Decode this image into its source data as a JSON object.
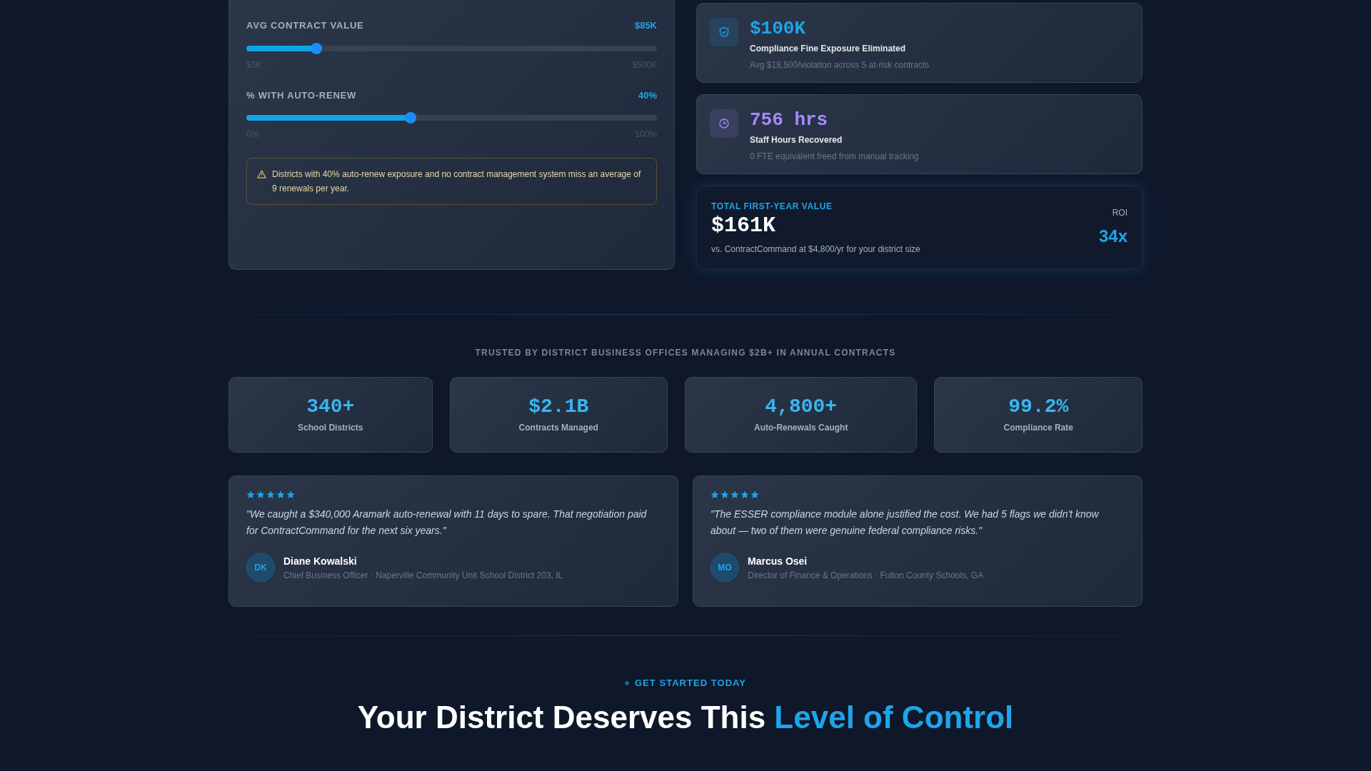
{
  "calculator": {
    "sliders": [
      {
        "label": "AVG CONTRACT VALUE",
        "reading": "$85K",
        "level": 0.17,
        "min_label": "$5K",
        "max_label": "$500K"
      },
      {
        "label": "% WITH AUTO-RENEW",
        "reading": "40%",
        "level": 0.4,
        "min_label": "0%",
        "max_label": "100%"
      }
    ],
    "warning": "Districts with 40% auto-renew exposure and no contract management system miss an average of 9 renewals per year."
  },
  "results": [
    {
      "kind": "shield",
      "value": "$100K",
      "title": "Compliance Fine Exposure Eliminated",
      "detail": "Avg $18,500/violation across 5 at-risk contracts",
      "color": "#1ea5e9"
    },
    {
      "kind": "clock",
      "value": "756 hrs",
      "title": "Staff Hours Recovered",
      "detail": "0 FTE equivalent freed from manual tracking",
      "color": "#a78bfa"
    }
  ],
  "total": {
    "label": "TOTAL FIRST-YEAR VALUE",
    "value": "$161K",
    "note": "vs. ContractCommand at $4,800/yr for your district size",
    "roi_label": "ROI",
    "roi": "34x"
  },
  "trust": {
    "heading": "TRUSTED BY DISTRICT BUSINESS OFFICES MANAGING $2B+ IN ANNUAL CONTRACTS",
    "stats": [
      {
        "value": "340+",
        "label": "School Districts"
      },
      {
        "value": "$2.1B",
        "label": "Contracts Managed"
      },
      {
        "value": "4,800+",
        "label": "Auto-Renewals Caught"
      },
      {
        "value": "99.2%",
        "label": "Compliance Rate"
      }
    ]
  },
  "testimonials": [
    {
      "stars": 5,
      "quote": "\"We caught a $340,000 Aramark auto-renewal with 11 days to spare. That negotiation paid for ContractCommand for the next six years.\"",
      "initials": "DK",
      "name": "Diane Kowalski",
      "role": "Chief Business Officer · Naperville Community Unit School District 203, IL"
    },
    {
      "stars": 5,
      "quote": "\"The ESSER compliance module alone justified the cost. We had 5 flags we didn't know about — two of them were genuine federal compliance risks.\"",
      "initials": "MO",
      "name": "Marcus Osei",
      "role": "Director of Finance & Operations · Fulton County Schools, GA"
    }
  ],
  "cta": {
    "eyebrow": "GET STARTED TODAY",
    "title_lead": "Your District Deserves This",
    "title_highlight": "Level of Control"
  }
}
